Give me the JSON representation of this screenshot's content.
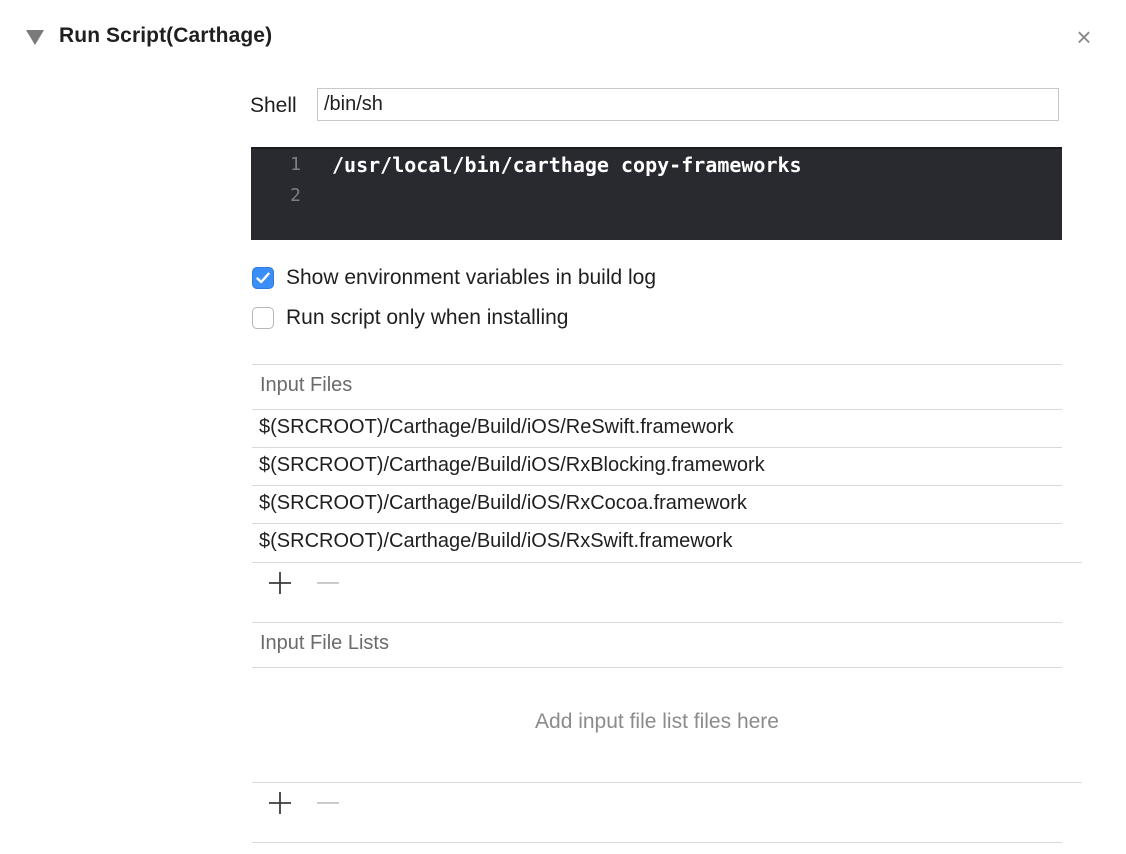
{
  "phase": {
    "title": "Run Script(Carthage)",
    "close_glyph": "×"
  },
  "shell": {
    "label": "Shell",
    "value": "/bin/sh"
  },
  "script": {
    "lines": [
      {
        "number": "1",
        "code": "/usr/local/bin/carthage copy-frameworks"
      },
      {
        "number": "2",
        "code": ""
      }
    ]
  },
  "options": {
    "show_env": {
      "label": "Show environment variables in build log",
      "checked": true
    },
    "run_on_install": {
      "label": "Run script only when installing",
      "checked": false
    }
  },
  "input_files": {
    "header": "Input Files",
    "items": [
      "$(SRCROOT)/Carthage/Build/iOS/ReSwift.framework",
      "$(SRCROOT)/Carthage/Build/iOS/RxBlocking.framework",
      "$(SRCROOT)/Carthage/Build/iOS/RxCocoa.framework",
      "$(SRCROOT)/Carthage/Build/iOS/RxSwift.framework"
    ]
  },
  "input_file_lists": {
    "header": "Input File Lists",
    "placeholder": "Add input file list files here"
  },
  "icons": {
    "disclosure": "disclosure-triangle-icon",
    "close": "close-icon",
    "add": "plus-icon",
    "remove": "minus-icon",
    "check": "checkmark-icon"
  },
  "colors": {
    "editor_background": "#292a30",
    "checkbox_accent": "#3a8ef6",
    "line_number": "#7d7f86"
  }
}
